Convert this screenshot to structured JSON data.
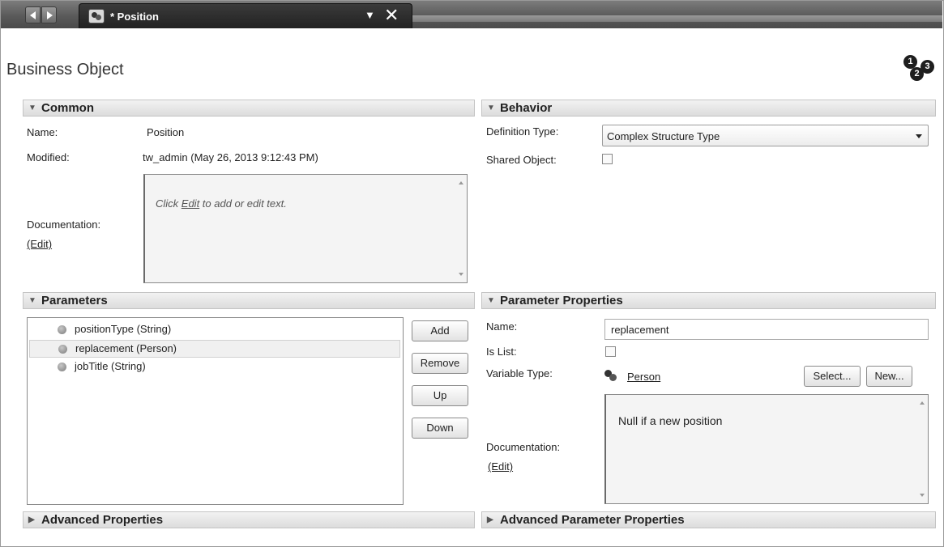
{
  "tab": {
    "title": "* Position",
    "dropdown_icon": "chevron-down-icon",
    "close_icon": "close-icon"
  },
  "page": {
    "title": "Business Object",
    "step_icon": [
      "1",
      "2",
      "3"
    ]
  },
  "common": {
    "header": "Common",
    "name_label": "Name:",
    "name_value": "Position",
    "modified_label": "Modified:",
    "modified_value": "tw_admin (May 26, 2013 9:12:43 PM)",
    "documentation_label": "Documentation:",
    "edit_link": "(Edit)",
    "doc_placeholder_pre": "Click ",
    "doc_placeholder_link": "Edit",
    "doc_placeholder_post": " to add or edit text."
  },
  "behavior": {
    "header": "Behavior",
    "definition_type_label": "Definition Type:",
    "definition_type_value": "Complex Structure Type",
    "shared_object_label": "Shared Object:",
    "shared_object_checked": false
  },
  "parameters": {
    "header": "Parameters",
    "items": [
      {
        "label": "positionType (String)",
        "selected": false
      },
      {
        "label": "replacement (Person)",
        "selected": true
      },
      {
        "label": "jobTitle (String)",
        "selected": false
      }
    ],
    "buttons": {
      "add": "Add",
      "remove": "Remove",
      "up": "Up",
      "down": "Down"
    }
  },
  "parameter_properties": {
    "header": "Parameter Properties",
    "name_label": "Name:",
    "name_value": "replacement",
    "is_list_label": "Is List:",
    "is_list_checked": false,
    "variable_type_label": "Variable Type:",
    "variable_type_value": "Person",
    "select_button": "Select...",
    "new_button": "New...",
    "documentation_label": "Documentation:",
    "edit_link": "(Edit)",
    "documentation_text": "Null if a new position"
  },
  "advanced": {
    "properties_header": "Advanced Properties",
    "parameter_properties_header": "Advanced Parameter Properties"
  }
}
